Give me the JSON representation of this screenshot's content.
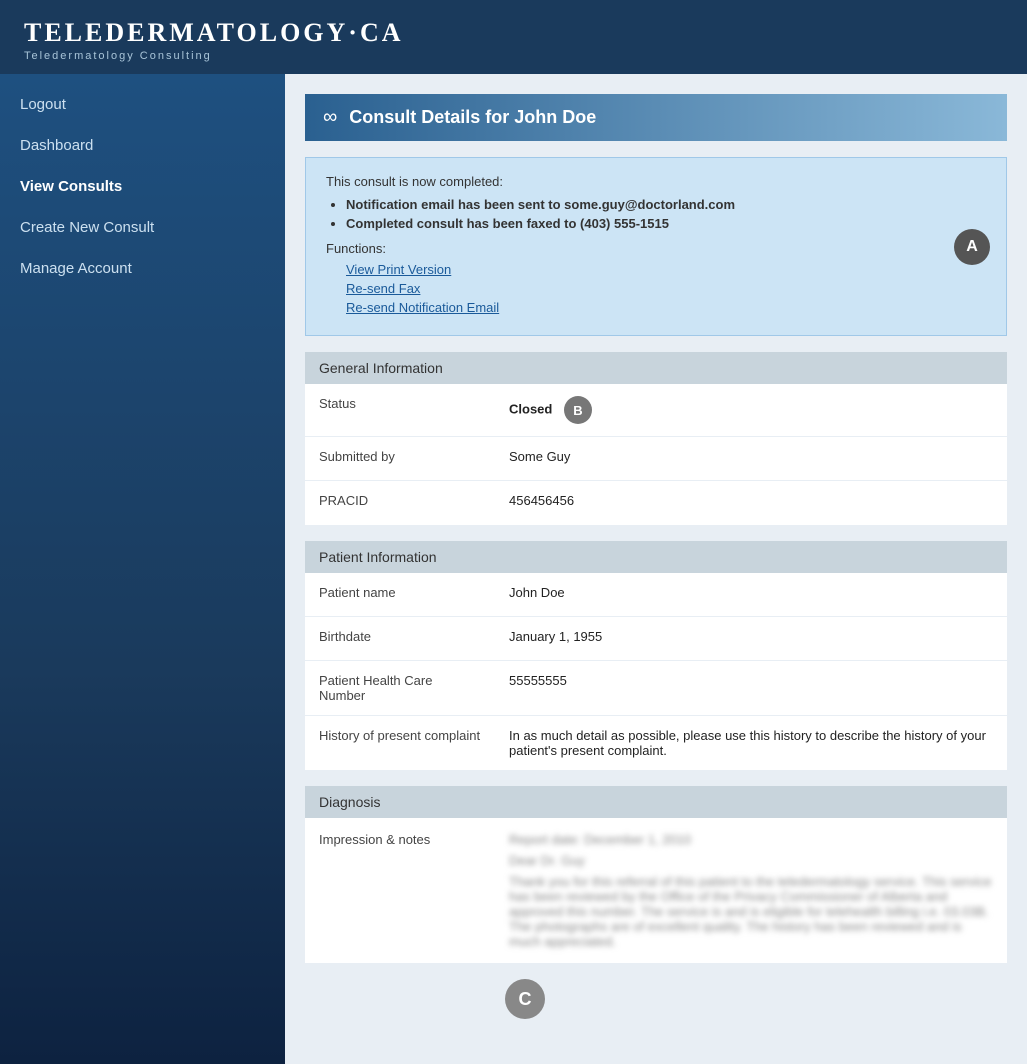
{
  "header": {
    "title": "TELEDERMATOLOGY·CA",
    "subtitle": "Teledermatology Consulting"
  },
  "sidebar": {
    "items": [
      {
        "id": "logout",
        "label": "Logout",
        "active": false
      },
      {
        "id": "dashboard",
        "label": "Dashboard",
        "active": false
      },
      {
        "id": "view-consults",
        "label": "View Consults",
        "active": true
      },
      {
        "id": "create-new-consult",
        "label": "Create New Consult",
        "active": false
      },
      {
        "id": "manage-account",
        "label": "Manage Account",
        "active": false
      }
    ]
  },
  "page": {
    "header_icon": "∞",
    "header_title": "Consult Details for John Doe"
  },
  "notification": {
    "title": "This consult is now completed:",
    "bullets": [
      "Notification email has been sent to some.guy@doctorland.com",
      "Completed consult has been faxed to (403) 555-1515"
    ],
    "functions_label": "Functions:",
    "links": [
      "View Print Version",
      "Re-send Fax",
      "Re-send Notification Email"
    ],
    "badge": "A"
  },
  "general_info": {
    "section_title": "General Information",
    "fields": [
      {
        "label": "Status",
        "value": "Closed",
        "bold": true,
        "badge": "B"
      },
      {
        "label": "Submitted by",
        "value": "Some Guy",
        "bold": false
      },
      {
        "label": "PRACID",
        "value": "456456456",
        "bold": false
      }
    ]
  },
  "patient_info": {
    "section_title": "Patient Information",
    "fields": [
      {
        "label": "Patient name",
        "value": "John Doe"
      },
      {
        "label": "Birthdate",
        "value": "January 1, 1955"
      },
      {
        "label": "Patient Health Care Number",
        "value": "55555555"
      },
      {
        "label": "History of present complaint",
        "value": "In as much detail as possible, please use this history to describe the history of your patient's present complaint."
      }
    ]
  },
  "diagnosis": {
    "section_title": "Diagnosis",
    "fields": [
      {
        "label": "Impression & notes",
        "value_blurred": true,
        "lines": [
          "Report date: December 1, 2010",
          "Dear Dr. Guy",
          "Thank you for this referral of this patient to the teledermatology service. This service has been reviewed by the Office of the Privacy Commissioner of Alberta and approved this number. The service is and is eligible for telehealth billing i.e. 03.03B. The photographs are of excellent quality. The history has been reviewed and is much appreciated."
        ]
      }
    ]
  },
  "badge_c": "C"
}
